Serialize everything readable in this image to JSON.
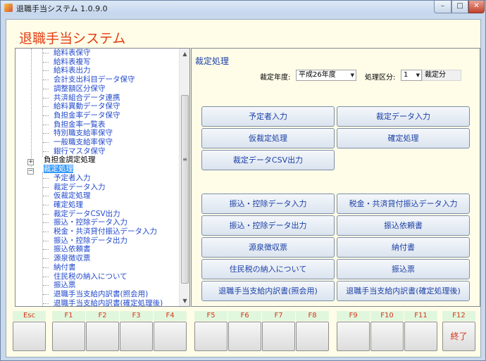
{
  "window": {
    "title": "退職手当システム 1.0.9.0",
    "minimize": "–",
    "maximize": "□",
    "close": "✕"
  },
  "app_title": "退職手当システム",
  "tree": {
    "items": [
      {
        "label": "給料表保守"
      },
      {
        "label": "給料表複写"
      },
      {
        "label": "給料表出力"
      },
      {
        "label": "会計支出科目データ保守"
      },
      {
        "label": "調整額区分保守"
      },
      {
        "label": "共済組合データ連携"
      },
      {
        "label": "給料異動データ保守"
      },
      {
        "label": "負担金率データ保守"
      },
      {
        "label": "負担金率一覧表"
      },
      {
        "label": "特別職支給率保守"
      },
      {
        "label": "一般職支給率保守"
      },
      {
        "label": "銀行マスタ保守"
      },
      {
        "label": "負担金調定処理"
      },
      {
        "label": "裁定処理"
      },
      {
        "label": "予定者入力"
      },
      {
        "label": "裁定データ入力"
      },
      {
        "label": "仮裁定処理"
      },
      {
        "label": "確定処理"
      },
      {
        "label": "裁定データCSV出力"
      },
      {
        "label": "振込・控除データ入力"
      },
      {
        "label": "税金・共済貸付振込データ入力"
      },
      {
        "label": "振込・控除データ出力"
      },
      {
        "label": "振込依頼書"
      },
      {
        "label": "源泉徴収票"
      },
      {
        "label": "納付書"
      },
      {
        "label": "住民税の納入について"
      },
      {
        "label": "振込票"
      },
      {
        "label": "退職手当支給内訳書(照会用)"
      },
      {
        "label": "退職手当支給内訳書(確定処理後)"
      }
    ],
    "expander_collapsed": "+",
    "expander_expanded": "−"
  },
  "main": {
    "section_title": "裁定処理",
    "fiscal_year_label": "裁定年度:",
    "fiscal_year_value": "平成26年度",
    "category_label": "処理区分:",
    "category_value": "1",
    "category_text": "裁定分",
    "buttons": [
      "予定者入力",
      "裁定データ入力",
      "仮裁定処理",
      "確定処理",
      "裁定データCSV出力",
      "振込・控除データ入力",
      "税金・共済貸付振込データ入力",
      "振込・控除データ出力",
      "振込依頼書",
      "源泉徴収票",
      "納付書",
      "住民税の納入について",
      "振込票",
      "退職手当支給内訳書(照会用)",
      "退職手当支給内訳書(確定処理後)"
    ]
  },
  "fkeys": {
    "headers": [
      "Esc",
      "F1",
      "F2",
      "F3",
      "F4",
      "F5",
      "F6",
      "F7",
      "F8",
      "F9",
      "F10",
      "F11",
      "F12"
    ],
    "f12_label": "終了"
  },
  "icons": {
    "dropdown": "▼",
    "scroll_up": "▲",
    "scroll_down": "▼",
    "grip": "≡"
  },
  "colors": {
    "app_title": "#e23d12",
    "link_text": "#2149cc",
    "selected_bg": "#3399ff",
    "fkey_header_bg": "#e1f7dd",
    "fkey_text": "#d9351b"
  }
}
